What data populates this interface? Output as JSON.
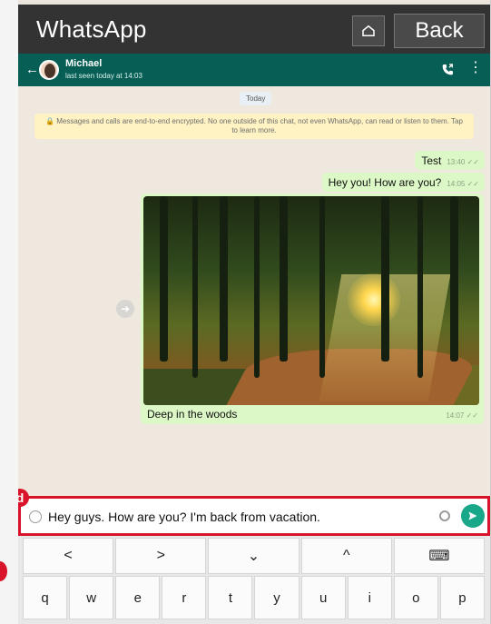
{
  "app": {
    "title": "WhatsApp",
    "home_icon": "home-outline-icon",
    "back_label": "Back"
  },
  "chat_header": {
    "name": "Michael",
    "status": "last seen today at 14:03",
    "back_icon": "←",
    "call_icon": "phone-icon",
    "menu_icon": "⋮"
  },
  "chat": {
    "date_label": "Today",
    "security_note": "🔒 Messages and calls are end-to-end encrypted. No one outside of this chat, not even WhatsApp, can read or listen to them. Tap to learn more.",
    "messages": [
      {
        "text": "Test",
        "time": "13:40 ✓✓"
      },
      {
        "text": "Hey you! How are you?",
        "time": "14:05 ✓✓"
      }
    ],
    "image_message": {
      "caption": "Deep in the woods",
      "time": "14:07 ✓✓",
      "share_icon": "share-arrow-icon"
    }
  },
  "composer": {
    "badge": "d",
    "text": "Hey guys. How are you? I'm back from vacation.",
    "emoji_icon": "emoji-icon",
    "attachment_icon": "paperclip-icon",
    "send_icon": "send-icon"
  },
  "keyboard": {
    "nav_keys": [
      "<",
      ">",
      "⌄",
      "^",
      "⌨"
    ],
    "letters": [
      "q",
      "w",
      "e",
      "r",
      "t",
      "y",
      "u",
      "i",
      "o",
      "p"
    ]
  },
  "colors": {
    "accent": "#075e54",
    "highlight": "#d8132a",
    "outgoing_bubble": "#dcf8c6",
    "send_button": "#18a889"
  }
}
